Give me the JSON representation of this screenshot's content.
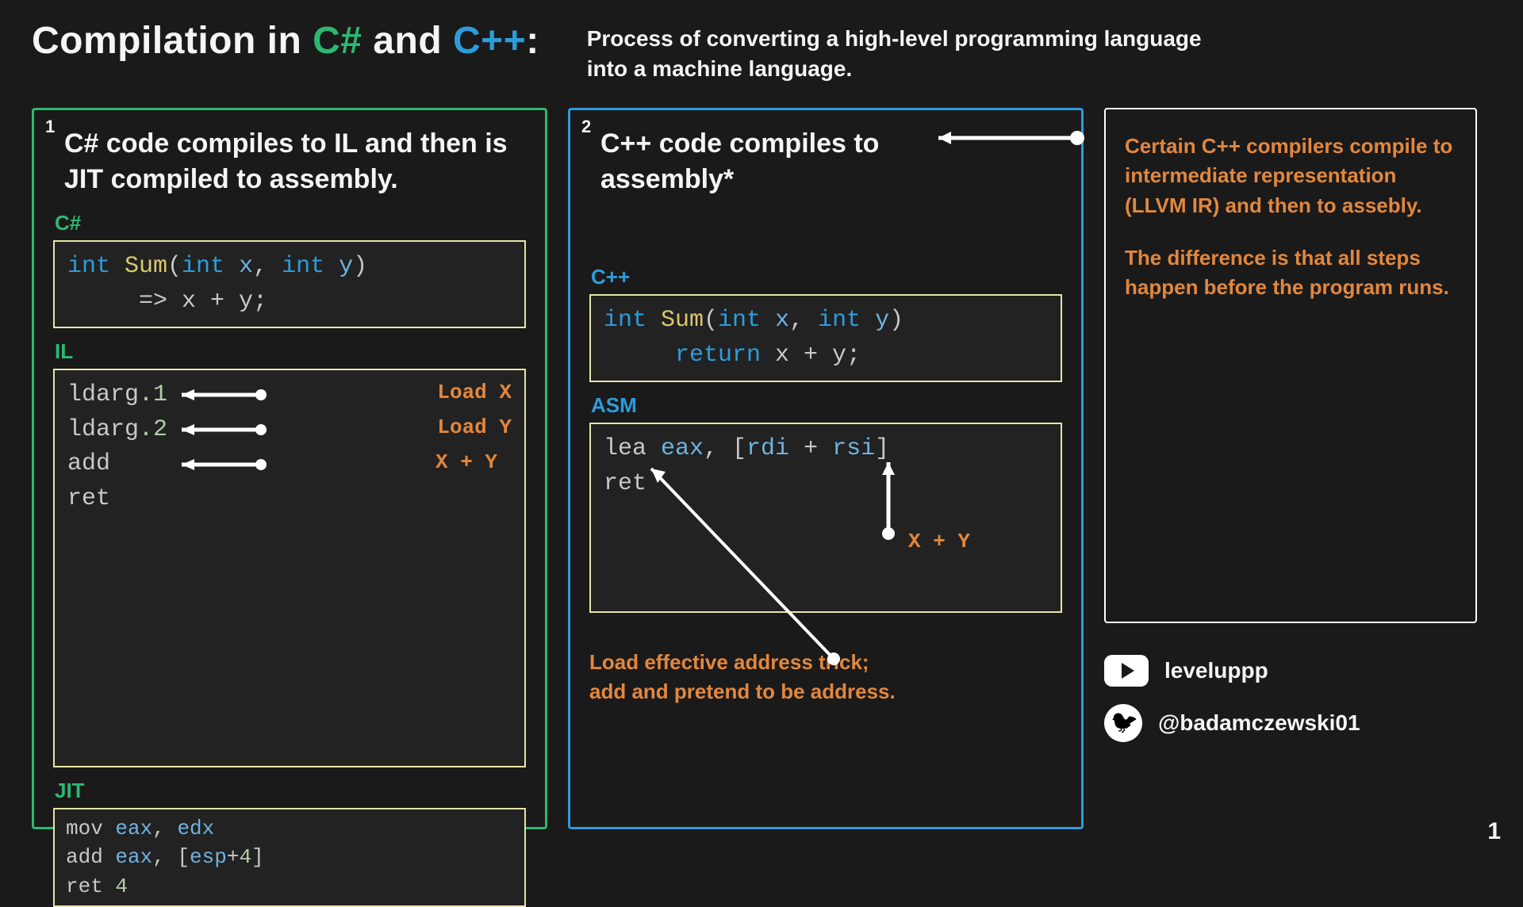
{
  "title": {
    "prefix": "Compilation in ",
    "csharp": "C#",
    "and": " and ",
    "cpp": "C++",
    "suffix": ":"
  },
  "subtitle": "Process of converting a high-level programming language into a machine language.",
  "csharp_panel": {
    "index": "1",
    "heading": "C# code compiles to IL and then is JIT compiled to assembly.",
    "label_csharp": "C#",
    "code_csharp_l1_kw1": "int",
    "code_csharp_l1_fn": " Sum",
    "code_csharp_l1_p1": "(",
    "code_csharp_l1_kw2": "int",
    "code_csharp_l1_v1": " x",
    "code_csharp_l1_c": ", ",
    "code_csharp_l1_kw3": "int",
    "code_csharp_l1_v2": " y",
    "code_csharp_l1_p2": ")",
    "code_csharp_l2": "     => x + y;",
    "label_il": "IL",
    "il_l1": "ldarg",
    "il_l1n": ".1",
    "il_l2": "ldarg",
    "il_l2n": ".2",
    "il_l3": "add",
    "il_l4": "ret",
    "il_a1": "Load X",
    "il_a2": "Load Y",
    "il_a3": "X + Y",
    "label_jit": "JIT",
    "jit_l1_a": "mov ",
    "jit_l1_r1": "eax",
    "jit_l1_c": ", ",
    "jit_l1_r2": "edx",
    "jit_l2_a": "add ",
    "jit_l2_r1": "eax",
    "jit_l2_c": ", [",
    "jit_l2_r2": "esp",
    "jit_l2_p": "+",
    "jit_l2_n": "4",
    "jit_l2_e": "]",
    "jit_l3_a": "ret ",
    "jit_l3_n": "4"
  },
  "cpp_panel": {
    "index": "2",
    "heading": "C++ code compiles to assembly*",
    "label_cpp": "C++",
    "code_cpp_l1_kw1": "int",
    "code_cpp_l1_fn": " Sum",
    "code_cpp_l1_p1": "(",
    "code_cpp_l1_kw2": "int",
    "code_cpp_l1_v1": " x",
    "code_cpp_l1_c": ", ",
    "code_cpp_l1_kw3": "int",
    "code_cpp_l1_v2": " y",
    "code_cpp_l1_p2": ")",
    "code_cpp_l2_pad": "     ",
    "code_cpp_l2_kw": "return",
    "code_cpp_l2_rest": " x + y;",
    "label_asm": "ASM",
    "asm_l1_a": "lea ",
    "asm_l1_r1": "eax",
    "asm_l1_c1": ", [",
    "asm_l1_r2": "rdi",
    "asm_l1_p": " + ",
    "asm_l1_r3": "rsi",
    "asm_l1_c2": "]",
    "asm_l2": "ret",
    "asm_annot": "X + Y",
    "lea_note_l1": "Load effective address trick;",
    "lea_note_l2": "add and pretend to be address."
  },
  "side_note": {
    "p1": "Certain C++ compilers compile to intermediate representation (LLVM IR) and then to assebly.",
    "p2": "The difference is that all steps happen before the program runs."
  },
  "socials": {
    "youtube": "leveluppp",
    "twitter": "@badamczewski01"
  },
  "page": "1"
}
